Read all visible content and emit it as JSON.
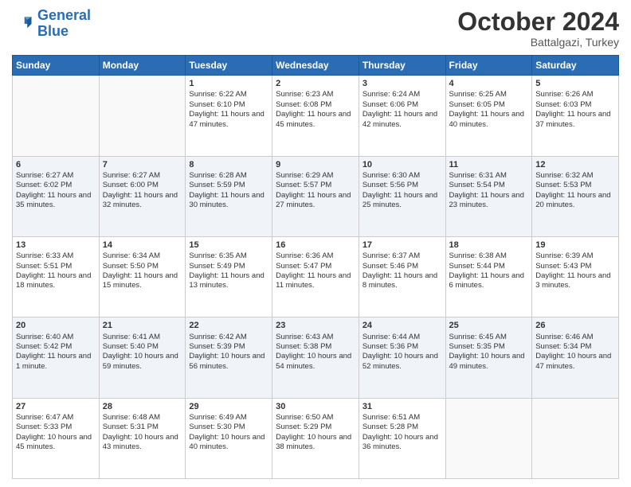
{
  "header": {
    "logo_line1": "General",
    "logo_line2": "Blue",
    "month": "October 2024",
    "location": "Battalgazi, Turkey"
  },
  "days_of_week": [
    "Sunday",
    "Monday",
    "Tuesday",
    "Wednesday",
    "Thursday",
    "Friday",
    "Saturday"
  ],
  "weeks": [
    [
      {
        "day": "",
        "info": ""
      },
      {
        "day": "",
        "info": ""
      },
      {
        "day": "1",
        "info": "Sunrise: 6:22 AM\nSunset: 6:10 PM\nDaylight: 11 hours and 47 minutes."
      },
      {
        "day": "2",
        "info": "Sunrise: 6:23 AM\nSunset: 6:08 PM\nDaylight: 11 hours and 45 minutes."
      },
      {
        "day": "3",
        "info": "Sunrise: 6:24 AM\nSunset: 6:06 PM\nDaylight: 11 hours and 42 minutes."
      },
      {
        "day": "4",
        "info": "Sunrise: 6:25 AM\nSunset: 6:05 PM\nDaylight: 11 hours and 40 minutes."
      },
      {
        "day": "5",
        "info": "Sunrise: 6:26 AM\nSunset: 6:03 PM\nDaylight: 11 hours and 37 minutes."
      }
    ],
    [
      {
        "day": "6",
        "info": "Sunrise: 6:27 AM\nSunset: 6:02 PM\nDaylight: 11 hours and 35 minutes."
      },
      {
        "day": "7",
        "info": "Sunrise: 6:27 AM\nSunset: 6:00 PM\nDaylight: 11 hours and 32 minutes."
      },
      {
        "day": "8",
        "info": "Sunrise: 6:28 AM\nSunset: 5:59 PM\nDaylight: 11 hours and 30 minutes."
      },
      {
        "day": "9",
        "info": "Sunrise: 6:29 AM\nSunset: 5:57 PM\nDaylight: 11 hours and 27 minutes."
      },
      {
        "day": "10",
        "info": "Sunrise: 6:30 AM\nSunset: 5:56 PM\nDaylight: 11 hours and 25 minutes."
      },
      {
        "day": "11",
        "info": "Sunrise: 6:31 AM\nSunset: 5:54 PM\nDaylight: 11 hours and 23 minutes."
      },
      {
        "day": "12",
        "info": "Sunrise: 6:32 AM\nSunset: 5:53 PM\nDaylight: 11 hours and 20 minutes."
      }
    ],
    [
      {
        "day": "13",
        "info": "Sunrise: 6:33 AM\nSunset: 5:51 PM\nDaylight: 11 hours and 18 minutes."
      },
      {
        "day": "14",
        "info": "Sunrise: 6:34 AM\nSunset: 5:50 PM\nDaylight: 11 hours and 15 minutes."
      },
      {
        "day": "15",
        "info": "Sunrise: 6:35 AM\nSunset: 5:49 PM\nDaylight: 11 hours and 13 minutes."
      },
      {
        "day": "16",
        "info": "Sunrise: 6:36 AM\nSunset: 5:47 PM\nDaylight: 11 hours and 11 minutes."
      },
      {
        "day": "17",
        "info": "Sunrise: 6:37 AM\nSunset: 5:46 PM\nDaylight: 11 hours and 8 minutes."
      },
      {
        "day": "18",
        "info": "Sunrise: 6:38 AM\nSunset: 5:44 PM\nDaylight: 11 hours and 6 minutes."
      },
      {
        "day": "19",
        "info": "Sunrise: 6:39 AM\nSunset: 5:43 PM\nDaylight: 11 hours and 3 minutes."
      }
    ],
    [
      {
        "day": "20",
        "info": "Sunrise: 6:40 AM\nSunset: 5:42 PM\nDaylight: 11 hours and 1 minute."
      },
      {
        "day": "21",
        "info": "Sunrise: 6:41 AM\nSunset: 5:40 PM\nDaylight: 10 hours and 59 minutes."
      },
      {
        "day": "22",
        "info": "Sunrise: 6:42 AM\nSunset: 5:39 PM\nDaylight: 10 hours and 56 minutes."
      },
      {
        "day": "23",
        "info": "Sunrise: 6:43 AM\nSunset: 5:38 PM\nDaylight: 10 hours and 54 minutes."
      },
      {
        "day": "24",
        "info": "Sunrise: 6:44 AM\nSunset: 5:36 PM\nDaylight: 10 hours and 52 minutes."
      },
      {
        "day": "25",
        "info": "Sunrise: 6:45 AM\nSunset: 5:35 PM\nDaylight: 10 hours and 49 minutes."
      },
      {
        "day": "26",
        "info": "Sunrise: 6:46 AM\nSunset: 5:34 PM\nDaylight: 10 hours and 47 minutes."
      }
    ],
    [
      {
        "day": "27",
        "info": "Sunrise: 6:47 AM\nSunset: 5:33 PM\nDaylight: 10 hours and 45 minutes."
      },
      {
        "day": "28",
        "info": "Sunrise: 6:48 AM\nSunset: 5:31 PM\nDaylight: 10 hours and 43 minutes."
      },
      {
        "day": "29",
        "info": "Sunrise: 6:49 AM\nSunset: 5:30 PM\nDaylight: 10 hours and 40 minutes."
      },
      {
        "day": "30",
        "info": "Sunrise: 6:50 AM\nSunset: 5:29 PM\nDaylight: 10 hours and 38 minutes."
      },
      {
        "day": "31",
        "info": "Sunrise: 6:51 AM\nSunset: 5:28 PM\nDaylight: 10 hours and 36 minutes."
      },
      {
        "day": "",
        "info": ""
      },
      {
        "day": "",
        "info": ""
      }
    ]
  ]
}
